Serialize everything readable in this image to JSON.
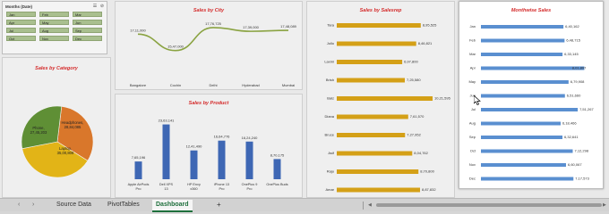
{
  "colors": {
    "title_red": "#d42a2a",
    "city_line": "#8aa342",
    "bar_blue": "#3e67b4",
    "bar_gold": "#d4a017",
    "month_bar": "#5a8fd0",
    "pie_orange": "#d9772b",
    "pie_yellow": "#e2b417",
    "pie_green": "#5f8f35"
  },
  "slicer": {
    "title": "Months (Date)",
    "items": [
      "Jan",
      "Feb",
      "Mar",
      "Apr",
      "May",
      "Jun",
      "Jul",
      "Aug",
      "Sep",
      "Oct",
      "Nov",
      "Dec"
    ]
  },
  "city_chart": {
    "title": "Sales by City",
    "type": "line",
    "categories": [
      "Bangalore",
      "Cochin",
      "Delhi",
      "Hyderabad",
      "Mumbai"
    ],
    "values": [
      17110000,
      15470000,
      17760000,
      17390000,
      17480000
    ],
    "labels": [
      "17,11,000",
      "15,47,000",
      "17,76,725",
      "17,39,000",
      "17,48,089"
    ]
  },
  "category_chart": {
    "title": "Sales by Category",
    "type": "pie",
    "slices": [
      {
        "label": "Headphones,",
        "value_label": "28,84,085",
        "share": 0.32
      },
      {
        "label": "Laptop,",
        "value_label": "35,00,808",
        "share": 0.38
      },
      {
        "label": "Phone,",
        "value_label": "27,45,203",
        "share": 0.3
      }
    ]
  },
  "product_chart": {
    "title": "Sales by Product",
    "type": "bar",
    "categories": [
      "Apple AirPods Pro",
      "Dell XPS 13",
      "HP Envy x360",
      "iPhone 13 Pro",
      "OnePlus 9 Pro",
      "OnePlus Buds"
    ],
    "values": [
      765196,
      2363141,
      1241490,
      1664776,
      1624240,
      870175
    ],
    "labels": [
      "7,65,196",
      "23,63,141",
      "12,41,490",
      "16,64,776",
      "16,24,240",
      "8,70,175"
    ]
  },
  "salesrep_chart": {
    "title": "Sales by Salesrep",
    "type": "bar",
    "categories": [
      "Tara",
      "Jollo",
      "Laxmi",
      "Brish",
      "Balz",
      "Diana",
      "Bruce",
      "Asif",
      "Raju",
      "Amar"
    ],
    "values": [
      895525,
      846821,
      697800,
      725580,
      1021595,
      761570,
      727952,
      804762,
      870800,
      887832
    ],
    "labels": [
      "8,95,525",
      "8,46,821",
      "6,97,800",
      "7,25,580",
      "10,21,595",
      "7,61,570",
      "7,27,952",
      "8,04,762",
      "8,70,800",
      "8,87,832"
    ]
  },
  "monthwise_chart": {
    "title": "Monthwise Sales",
    "type": "bar",
    "categories": [
      "Jan",
      "Feb",
      "Mar",
      "Apr",
      "May",
      "Jun",
      "Jul",
      "Aug",
      "Sep",
      "Oct",
      "Nov",
      "Dec"
    ],
    "values": [
      640162,
      648715,
      633145,
      801897,
      679908,
      651660,
      751267,
      618466,
      632641,
      712298,
      660067,
      717573
    ],
    "labels": [
      "6,40,162",
      "6,48,715",
      "6,33,145",
      "8,01,897",
      "6,79,908",
      "6,51,660",
      "7,51,267",
      "6,18,466",
      "6,32,641",
      "7,12,298",
      "6,60,067",
      "7,17,573"
    ]
  },
  "tabs": [
    "Source Data",
    "PivotTables",
    "Dashboard"
  ],
  "add_sheet": "+"
}
